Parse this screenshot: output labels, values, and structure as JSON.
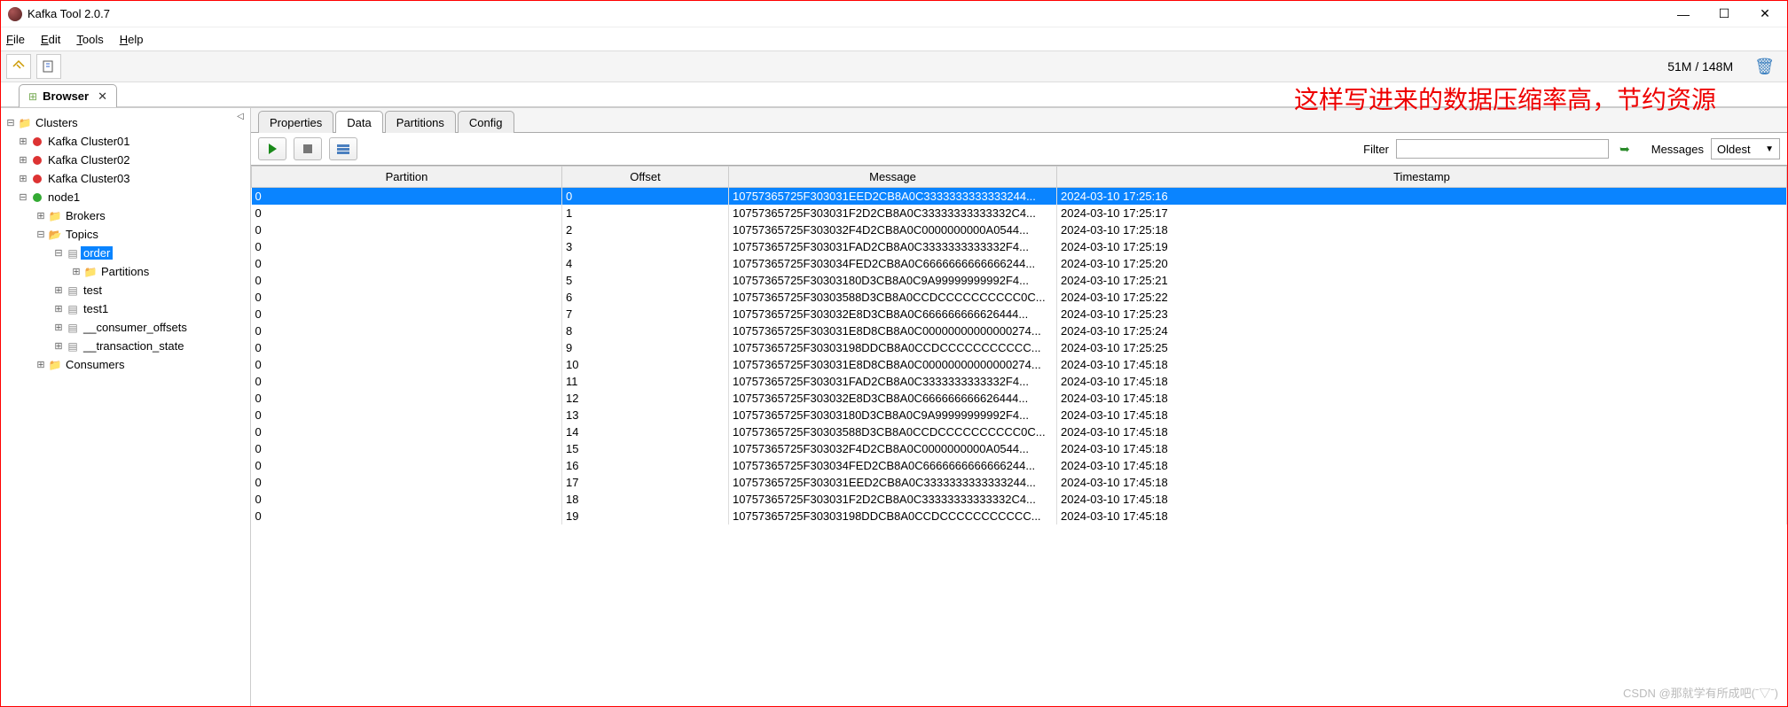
{
  "window": {
    "title": "Kafka Tool  2.0.7",
    "minimize": "—",
    "maximize": "☐",
    "close": "✕"
  },
  "menu": {
    "file": "File",
    "edit": "Edit",
    "tools": "Tools",
    "help": "Help"
  },
  "toolbar": {
    "memory": "51M / 148M"
  },
  "browserTab": {
    "label": "Browser",
    "close": "✕"
  },
  "overlayNote": "这样写进来的数据压缩率高，节约资源",
  "tree": {
    "root": "Clusters",
    "cluster01": "Kafka Cluster01",
    "cluster02": "Kafka Cluster02",
    "cluster03": "Kafka Cluster03",
    "node1": "node1",
    "brokers": "Brokers",
    "topics": "Topics",
    "order": "order",
    "partitions": "Partitions",
    "test": "test",
    "test1": "test1",
    "consumer_offsets": "__consumer_offsets",
    "transaction_state": "__transaction_state",
    "consumers": "Consumers"
  },
  "contentTabs": {
    "properties": "Properties",
    "data": "Data",
    "partitions": "Partitions",
    "config": "Config"
  },
  "filterBar": {
    "filterLabel": "Filter",
    "filterValue": "",
    "messagesLabel": "Messages",
    "messagesValue": "Oldest"
  },
  "columns": {
    "partition": "Partition",
    "offset": "Offset",
    "message": "Message",
    "timestamp": "Timestamp"
  },
  "rows": [
    {
      "partition": "0",
      "offset": "0",
      "message": "10757365725F303031EED2CB8A0C3333333333333244...",
      "timestamp": "2024-03-10 17:25:16"
    },
    {
      "partition": "0",
      "offset": "1",
      "message": "10757365725F303031F2D2CB8A0C33333333333332C4...",
      "timestamp": "2024-03-10 17:25:17"
    },
    {
      "partition": "0",
      "offset": "2",
      "message": "10757365725F303032F4D2CB8A0C0000000000A0544...",
      "timestamp": "2024-03-10 17:25:18"
    },
    {
      "partition": "0",
      "offset": "3",
      "message": "10757365725F303031FAD2CB8A0C3333333333332F4...",
      "timestamp": "2024-03-10 17:25:19"
    },
    {
      "partition": "0",
      "offset": "4",
      "message": "10757365725F303034FED2CB8A0C6666666666666244...",
      "timestamp": "2024-03-10 17:25:20"
    },
    {
      "partition": "0",
      "offset": "5",
      "message": "10757365725F30303180D3CB8A0C9A99999999992F4...",
      "timestamp": "2024-03-10 17:25:21"
    },
    {
      "partition": "0",
      "offset": "6",
      "message": "10757365725F30303588D3CB8A0CCDCCCCCCCCCC0C...",
      "timestamp": "2024-03-10 17:25:22"
    },
    {
      "partition": "0",
      "offset": "7",
      "message": "10757365725F303032E8D3CB8A0C666666666626444...",
      "timestamp": "2024-03-10 17:25:23"
    },
    {
      "partition": "0",
      "offset": "8",
      "message": "10757365725F303031E8D8CB8A0C00000000000000274...",
      "timestamp": "2024-03-10 17:25:24"
    },
    {
      "partition": "0",
      "offset": "9",
      "message": "10757365725F30303198DDCB8A0CCDCCCCCCCCCCC...",
      "timestamp": "2024-03-10 17:25:25"
    },
    {
      "partition": "0",
      "offset": "10",
      "message": "10757365725F303031E8D8CB8A0C00000000000000274...",
      "timestamp": "2024-03-10 17:45:18"
    },
    {
      "partition": "0",
      "offset": "11",
      "message": "10757365725F303031FAD2CB8A0C3333333333332F4...",
      "timestamp": "2024-03-10 17:45:18"
    },
    {
      "partition": "0",
      "offset": "12",
      "message": "10757365725F303032E8D3CB8A0C666666666626444...",
      "timestamp": "2024-03-10 17:45:18"
    },
    {
      "partition": "0",
      "offset": "13",
      "message": "10757365725F30303180D3CB8A0C9A99999999992F4...",
      "timestamp": "2024-03-10 17:45:18"
    },
    {
      "partition": "0",
      "offset": "14",
      "message": "10757365725F30303588D3CB8A0CCDCCCCCCCCCC0C...",
      "timestamp": "2024-03-10 17:45:18"
    },
    {
      "partition": "0",
      "offset": "15",
      "message": "10757365725F303032F4D2CB8A0C0000000000A0544...",
      "timestamp": "2024-03-10 17:45:18"
    },
    {
      "partition": "0",
      "offset": "16",
      "message": "10757365725F303034FED2CB8A0C6666666666666244...",
      "timestamp": "2024-03-10 17:45:18"
    },
    {
      "partition": "0",
      "offset": "17",
      "message": "10757365725F303031EED2CB8A0C3333333333333244...",
      "timestamp": "2024-03-10 17:45:18"
    },
    {
      "partition": "0",
      "offset": "18",
      "message": "10757365725F303031F2D2CB8A0C33333333333332C4...",
      "timestamp": "2024-03-10 17:45:18"
    },
    {
      "partition": "0",
      "offset": "19",
      "message": "10757365725F30303198DDCB8A0CCDCCCCCCCCCCC...",
      "timestamp": "2024-03-10 17:45:18"
    }
  ],
  "watermark": "CSDN @那就学有所成吧(ˉ▽ˉ)"
}
